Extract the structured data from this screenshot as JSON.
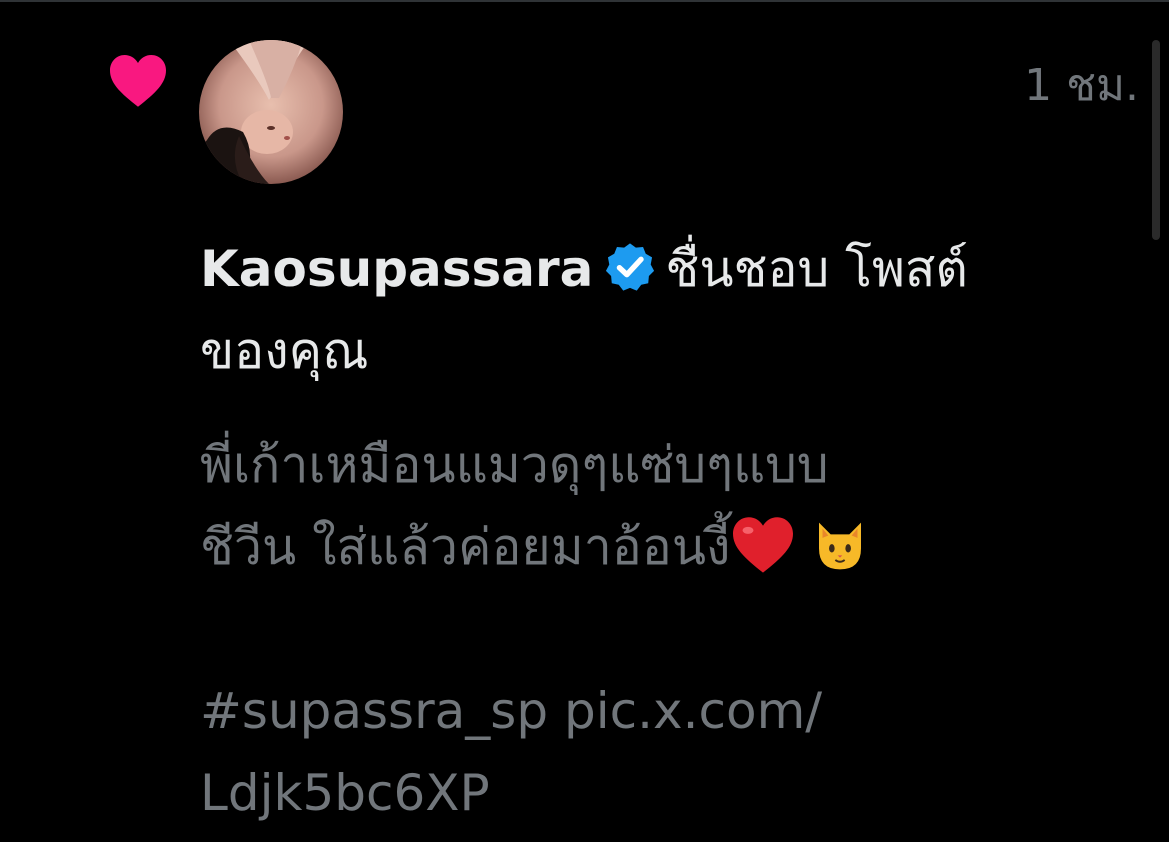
{
  "notification": {
    "timestamp": "1 ชม.",
    "username": "Kaosupassara",
    "action_line1": "ชื่นชอบ โพสต์",
    "action_line2": "ของคุณ",
    "post": {
      "line1": "พี่เก้าเหมือนแมวดุๆแซ่บๆแบบ",
      "line2": "ชีวีน ใส่แล้วค่อยมาอ้อนงี้",
      "line3": "#supassra_sp pic.x.com/",
      "line4": "Ldjk5bc6XP"
    }
  },
  "icons": {
    "like": "heart-icon",
    "verified": "verified-badge-icon",
    "emoji1": "red-heart-emoji",
    "emoji2": "cat-face-emoji"
  },
  "colors": {
    "background": "#000000",
    "like_heart": "#f91880",
    "verified": "#1d9bf0",
    "primary_text": "#e7e9ea",
    "secondary_text": "#71767b"
  }
}
